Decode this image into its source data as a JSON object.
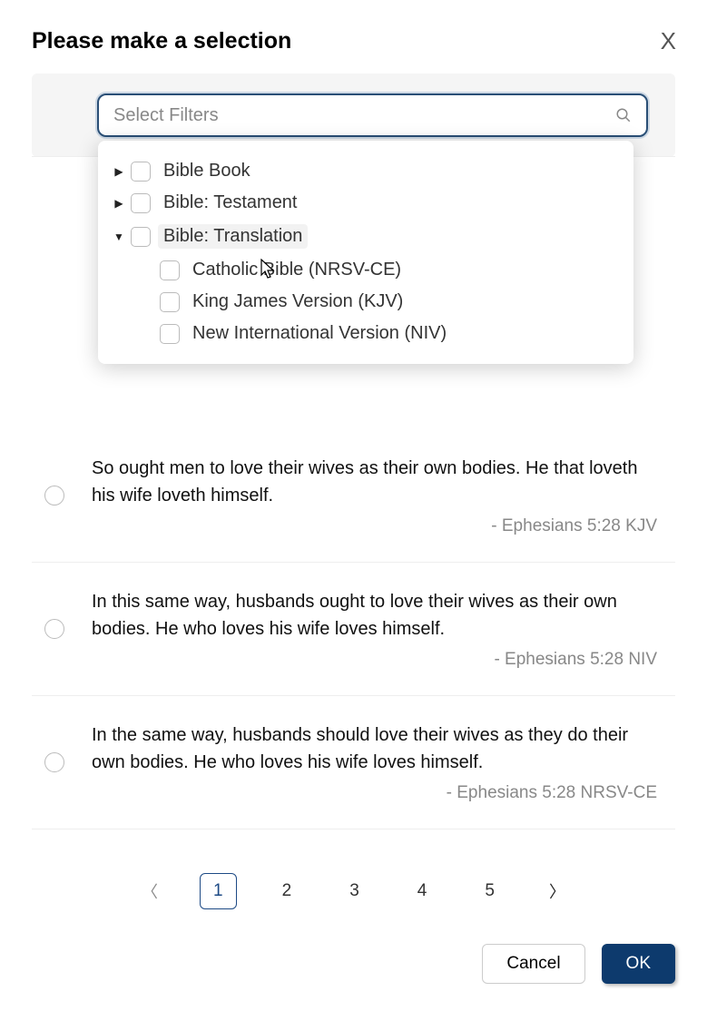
{
  "header": {
    "title": "Please make a selection",
    "close_label": "X"
  },
  "filter": {
    "placeholder": "Select Filters"
  },
  "tree": {
    "book": "Bible Book",
    "testament": "Bible: Testament",
    "translation": "Bible: Translation",
    "options": {
      "nrsv": "Catholic Bible (NRSV-CE)",
      "kjv": "King James Version (KJV)",
      "niv": "New International Version (NIV)"
    }
  },
  "verses": [
    {
      "text": "So ought men to love their wives as their own bodies. He that loveth his wife loveth himself.",
      "ref": "- Ephesians 5:28 KJV"
    },
    {
      "text": "In this same way, husbands ought to love their wives as their own bodies. He who loves his wife loves himself.",
      "ref": "- Ephesians 5:28 NIV"
    },
    {
      "text": "In the same way, husbands should love their wives as they do their own bodies. He who loves his wife loves himself.",
      "ref": "- Ephesians 5:28 NRSV-CE"
    }
  ],
  "pagination": {
    "pages": [
      "1",
      "2",
      "3",
      "4",
      "5"
    ],
    "current": 1
  },
  "footer": {
    "cancel": "Cancel",
    "ok": "OK"
  }
}
